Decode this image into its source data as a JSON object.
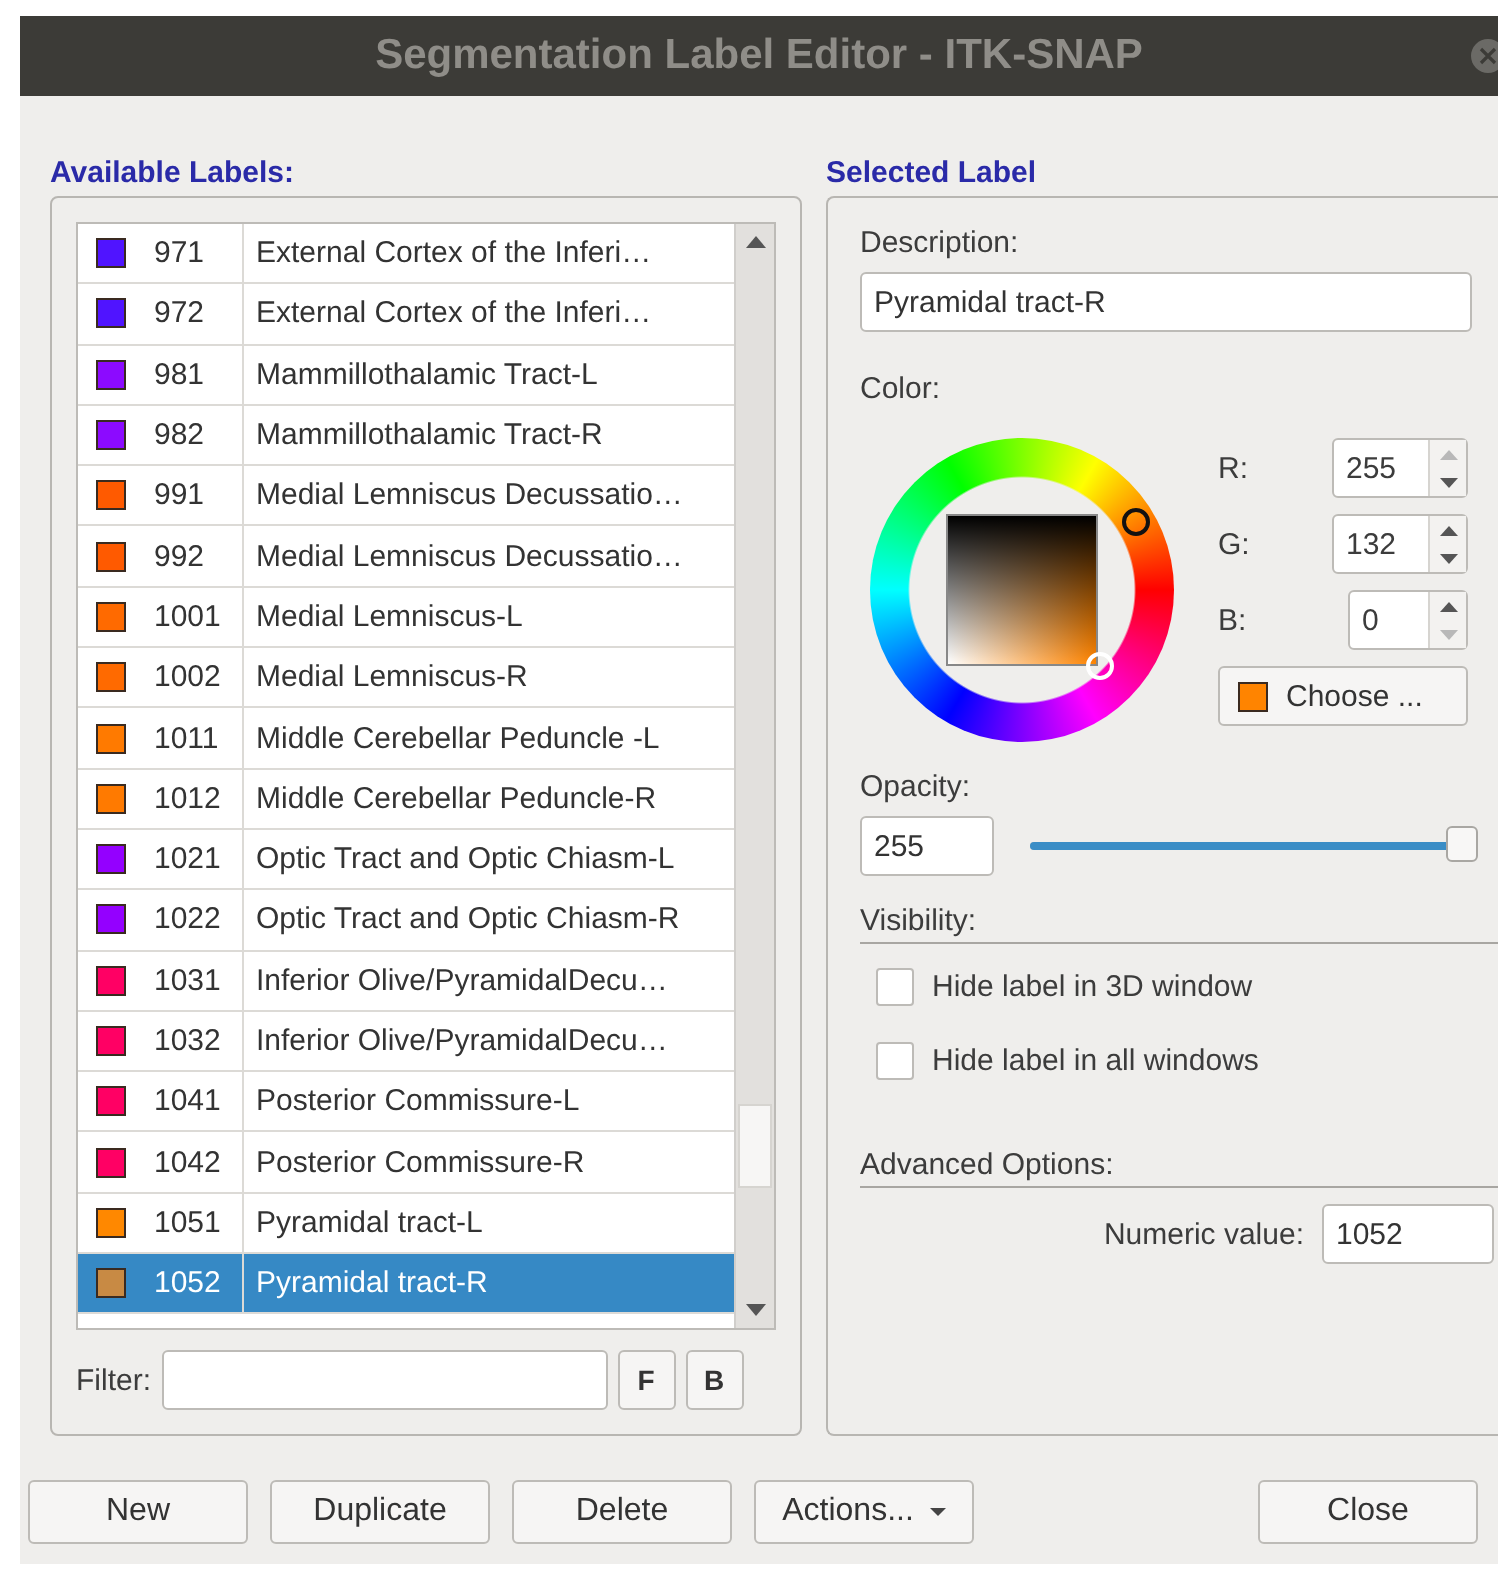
{
  "window": {
    "title": "Segmentation Label Editor - ITK-SNAP"
  },
  "available_labels": {
    "heading": "Available Labels:",
    "rows": [
      {
        "value": "971",
        "name": "External Cortex of the Inferi…",
        "color": "#5014ff",
        "selected": false
      },
      {
        "value": "972",
        "name": "External Cortex of the Inferi…",
        "color": "#5014ff",
        "selected": false
      },
      {
        "value": "981",
        "name": "Mammillothalamic Tract-L",
        "color": "#8c0aff",
        "selected": false
      },
      {
        "value": "982",
        "name": "Mammillothalamic Tract-R",
        "color": "#8c0aff",
        "selected": false
      },
      {
        "value": "991",
        "name": "Medial Lemniscus Decussatio…",
        "color": "#ff5a00",
        "selected": false
      },
      {
        "value": "992",
        "name": "Medial Lemniscus Decussatio…",
        "color": "#ff5a00",
        "selected": false
      },
      {
        "value": "1001",
        "name": "Medial Lemniscus-L",
        "color": "#ff6a00",
        "selected": false
      },
      {
        "value": "1002",
        "name": "Medial Lemniscus-R",
        "color": "#ff6a00",
        "selected": false
      },
      {
        "value": "1011",
        "name": "Middle Cerebellar Peduncle -L",
        "color": "#ff7a00",
        "selected": false
      },
      {
        "value": "1012",
        "name": "Middle Cerebellar Peduncle-R",
        "color": "#ff7a00",
        "selected": false
      },
      {
        "value": "1021",
        "name": "Optic Tract and Optic Chiasm-L",
        "color": "#9400ff",
        "selected": false
      },
      {
        "value": "1022",
        "name": "Optic Tract and Optic Chiasm-R",
        "color": "#9400ff",
        "selected": false
      },
      {
        "value": "1031",
        "name": "Inferior Olive/PyramidalDecu…",
        "color": "#ff0064",
        "selected": false
      },
      {
        "value": "1032",
        "name": "Inferior Olive/PyramidalDecu…",
        "color": "#ff0064",
        "selected": false
      },
      {
        "value": "1041",
        "name": "Posterior Commissure-L",
        "color": "#ff0064",
        "selected": false
      },
      {
        "value": "1042",
        "name": "Posterior Commissure-R",
        "color": "#ff0064",
        "selected": false
      },
      {
        "value": "1051",
        "name": "Pyramidal tract-L",
        "color": "#ff8800",
        "selected": false
      },
      {
        "value": "1052",
        "name": "Pyramidal tract-R",
        "color": "#c88a44",
        "selected": true
      }
    ],
    "filter": {
      "label": "Filter:"
    },
    "filter_buttons": [
      "F",
      "B"
    ]
  },
  "selected_label": {
    "heading": "Selected Label",
    "description": {
      "label": "Description:",
      "value": "Pyramidal tract-R"
    },
    "color": {
      "label": "Color:",
      "channels": [
        {
          "label": "R:",
          "value": "255",
          "up_disabled": true,
          "down_disabled": false
        },
        {
          "label": "G:",
          "value": "132",
          "up_disabled": false,
          "down_disabled": false
        },
        {
          "label": "B:",
          "value": "0",
          "up_disabled": false,
          "down_disabled": true
        }
      ],
      "choose_button": "Choose ..."
    },
    "opacity": {
      "label": "Opacity:",
      "value": "255",
      "level": 1
    },
    "visibility": {
      "heading": "Visibility:",
      "options": [
        {
          "label": "Hide label in 3D window",
          "checked": false
        },
        {
          "label": "Hide label in all windows",
          "checked": false
        }
      ]
    },
    "advanced": {
      "heading": "Advanced Options:",
      "numeric_label": "Numeric value:",
      "numeric_value": "1052"
    }
  },
  "buttons": [
    {
      "label": "New",
      "kind": "push"
    },
    {
      "label": "Duplicate",
      "kind": "push"
    },
    {
      "label": "Delete",
      "kind": "push"
    },
    {
      "label": "Actions...",
      "kind": "menu"
    },
    {
      "label": "Close",
      "kind": "push"
    }
  ]
}
